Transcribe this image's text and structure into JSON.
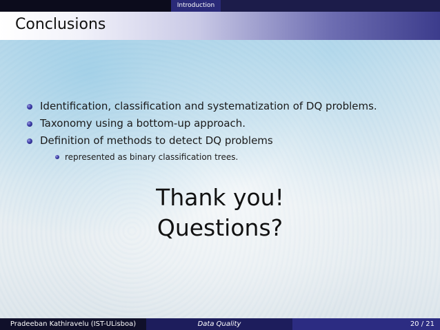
{
  "nav": {
    "section": "Introduction"
  },
  "slide": {
    "title": "Conclusions",
    "bullets": [
      "Identification, classification and systematization of DQ problems.",
      "Taxonomy using a bottom-up approach.",
      "Definition of methods to detect DQ problems"
    ],
    "sub_bullets": [
      "represented as binary classification trees."
    ],
    "closing_line1": "Thank you!",
    "closing_line2": "Questions?"
  },
  "footer": {
    "author": "Pradeeban Kathiravelu  (IST-ULisboa)",
    "talk_title": "Data Quality",
    "page": "20 / 21"
  },
  "colors": {
    "nav_dark": "#0c0c1c",
    "nav_active": "#2a2a78",
    "title_gradient_end": "#3c3c8c",
    "bullet": "#3d3da8"
  }
}
